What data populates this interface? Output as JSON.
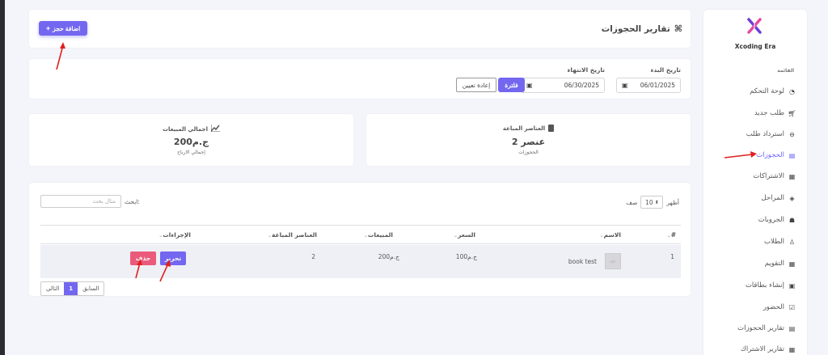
{
  "page": {
    "title": "تقارير الحجوزات",
    "add_button_label": "اضافة حجز"
  },
  "sidebar": {
    "brand": "Xcoding Era",
    "section_label": "القائمة",
    "items": [
      {
        "label": "لوحة التحكم",
        "icon": "dashboard-icon"
      },
      {
        "label": "طلب جديد",
        "icon": "cart-icon"
      },
      {
        "label": "استرداد طلب",
        "icon": "return-icon"
      },
      {
        "label": "الحجوزات",
        "icon": "book-icon",
        "active": true
      },
      {
        "label": "الاشتراكات",
        "icon": "calendar-icon"
      },
      {
        "label": "المراحل",
        "icon": "layers-icon"
      },
      {
        "label": "الجروبات",
        "icon": "users-icon"
      },
      {
        "label": "الطلاب",
        "icon": "student-icon"
      },
      {
        "label": "التقويم",
        "icon": "calendar-icon"
      },
      {
        "label": "إنشاء بطاقات",
        "icon": "id-card-icon"
      },
      {
        "label": "الحضور",
        "icon": "check-calendar-icon"
      },
      {
        "label": "تقارير الحجوزات",
        "icon": "book-icon"
      },
      {
        "label": "تقارير الاشتراك",
        "icon": "calendar-icon"
      }
    ]
  },
  "filter": {
    "start_label": "تاريخ البدء",
    "start_value": "06/01/2025",
    "end_label": "تاريخ الانتهاء",
    "end_value": "06/30/2025",
    "filter_button": "فلترة",
    "reset_button": "إعادة تعيين"
  },
  "stats": {
    "items_card": {
      "title": "العناصر المباعة",
      "value": "2 عنصر",
      "sub": "الحجوزات"
    },
    "sales_card": {
      "title": "اجمالي المبيعات",
      "value": "ج.م200",
      "sub": "إجمالي الارباح"
    }
  },
  "table": {
    "show_label": "أظهر",
    "page_size": "10",
    "rows_label": "صف",
    "search_label": "ابحث:",
    "search_placeholder": "مثال بحث",
    "columns": {
      "num": "#",
      "name": "الاسم",
      "price": "السعر",
      "sales": "المبيعات",
      "items_sold": "العناصر المباعة",
      "actions": "الإجراءات"
    },
    "rows": [
      {
        "num": "1",
        "name": "book test",
        "price": "ج.م100",
        "sales": "ج.م200",
        "items_sold": "2",
        "edit": "تحرير",
        "delete": "حذف"
      }
    ],
    "pagination": {
      "prev": "السابق",
      "current": "1",
      "next": "التالي"
    }
  },
  "colors": {
    "accent": "#7367f0",
    "danger": "#ea5a7a",
    "annotation": "#e02020"
  }
}
